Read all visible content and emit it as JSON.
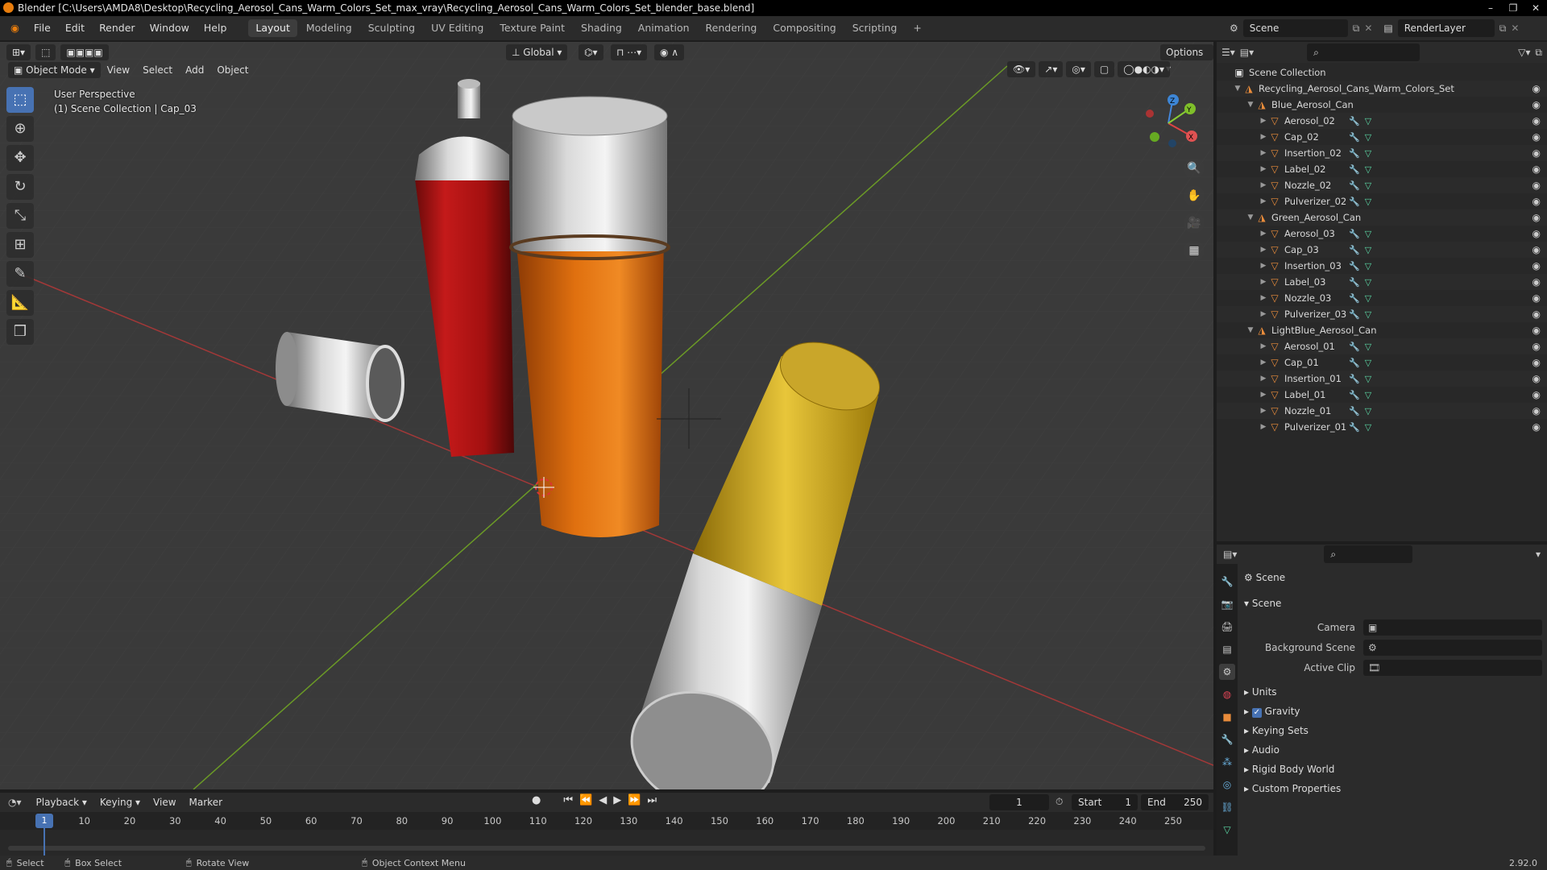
{
  "window": {
    "title": "Blender [C:\\Users\\AMDA8\\Desktop\\Recycling_Aerosol_Cans_Warm_Colors_Set_max_vray\\Recycling_Aerosol_Cans_Warm_Colors_Set_blender_base.blend]",
    "controls": [
      "–",
      "❐",
      "✕"
    ]
  },
  "menubar": [
    "File",
    "Edit",
    "Render",
    "Window",
    "Help"
  ],
  "workspaces": {
    "active": "Layout",
    "tabs": [
      "Layout",
      "Modeling",
      "Sculpting",
      "UV Editing",
      "Texture Paint",
      "Shading",
      "Animation",
      "Rendering",
      "Compositing",
      "Scripting"
    ],
    "add": "+"
  },
  "scene_field": "Scene",
  "renderlayer_field": "RenderLayer",
  "viewport": {
    "transform_orientation": "Global",
    "options_label": "Options",
    "mode": "Object Mode",
    "menus": [
      "View",
      "Select",
      "Add",
      "Object"
    ],
    "info_line1": "User Perspective",
    "info_line2": "(1) Scene Collection | Cap_03",
    "gizmo_axes": {
      "x": "X",
      "y": "Y",
      "z": "Z"
    }
  },
  "tools": [
    "select-box",
    "cursor",
    "move",
    "rotate",
    "scale",
    "transform",
    "annotate",
    "measure",
    "add-cube"
  ],
  "outliner": {
    "root": "Scene Collection",
    "top_collection": "Recycling_Aerosol_Cans_Warm_Colors_Set",
    "collections": [
      {
        "name": "Blue_Aerosol_Can",
        "objects": [
          "Aerosol_02",
          "Cap_02",
          "Insertion_02",
          "Label_02",
          "Nozzle_02",
          "Pulverizer_02"
        ]
      },
      {
        "name": "Green_Aerosol_Can",
        "objects": [
          "Aerosol_03",
          "Cap_03",
          "Insertion_03",
          "Label_03",
          "Nozzle_03",
          "Pulverizer_03"
        ]
      },
      {
        "name": "LightBlue_Aerosol_Can",
        "objects": [
          "Aerosol_01",
          "Cap_01",
          "Insertion_01",
          "Label_01",
          "Nozzle_01",
          "Pulverizer_01"
        ]
      }
    ]
  },
  "properties": {
    "header": "Scene",
    "section": "Scene",
    "fields": [
      {
        "label": "Camera",
        "value": ""
      },
      {
        "label": "Background Scene",
        "value": ""
      },
      {
        "label": "Active Clip",
        "value": ""
      }
    ],
    "subsections": [
      "Units",
      "Gravity",
      "Keying Sets",
      "Audio",
      "Rigid Body World",
      "Custom Properties"
    ],
    "gravity_checked": true
  },
  "timeline": {
    "menus": [
      "Playback",
      "Keying",
      "View",
      "Marker"
    ],
    "current_frame": "1",
    "start_label": "Start",
    "start": "1",
    "end_label": "End",
    "end": "250",
    "ticks": [
      "10",
      "20",
      "30",
      "40",
      "50",
      "60",
      "70",
      "80",
      "90",
      "100",
      "110",
      "120",
      "130",
      "140",
      "150",
      "160",
      "170",
      "180",
      "190",
      "200",
      "210",
      "220",
      "230",
      "240",
      "250"
    ],
    "playhead": "1"
  },
  "statusbar": {
    "select": "Select",
    "box_select": "Box Select",
    "rotate_view": "Rotate View",
    "context_menu": "Object Context Menu",
    "version": "2.92.0"
  }
}
